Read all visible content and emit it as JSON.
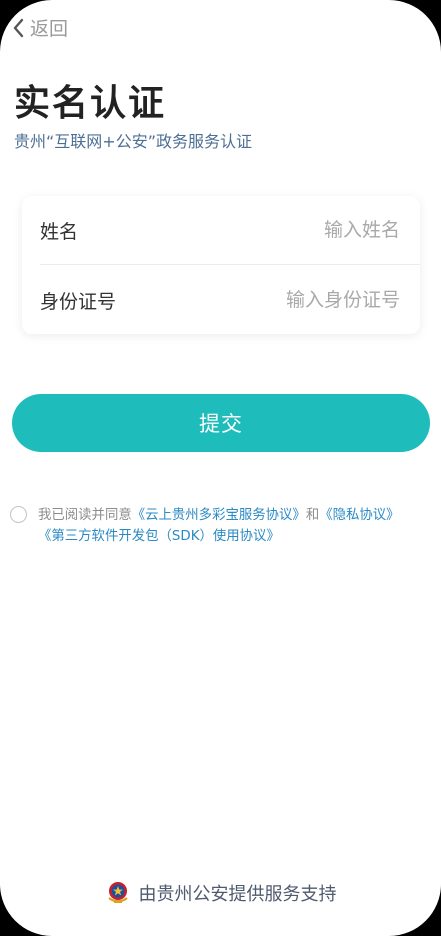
{
  "nav": {
    "back_label": "返回"
  },
  "header": {
    "title": "实名认证",
    "subtitle": "贵州“互联网+公安”政务服务认证"
  },
  "form": {
    "name_label": "姓名",
    "name_placeholder": "输入姓名",
    "name_value": "",
    "id_label": "身份证号",
    "id_placeholder": "输入身份证号",
    "id_value": ""
  },
  "submit_label": "提交",
  "agreement": {
    "checked": false,
    "prefix": "我已阅读并同意",
    "link1": "《云上贵州多彩宝服务协议》",
    "conjunction": "和",
    "link2": "《隐私协议》",
    "link3": "《第三方软件开发包（SDK）使用协议》"
  },
  "footer": {
    "text": "由贵州公安提供服务支持",
    "icon": "police-emblem-icon"
  },
  "colors": {
    "accent": "#1fbcbc",
    "link": "#2a8ac4",
    "subtitle": "#4d6f94"
  }
}
